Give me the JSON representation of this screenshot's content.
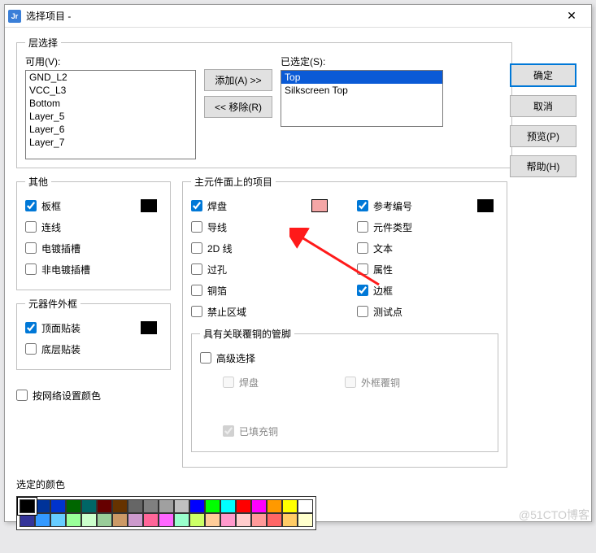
{
  "window": {
    "title": "选择项目 -"
  },
  "layerSelect": {
    "legend": "层选择",
    "availLabel": "可用(V):",
    "selectedLabel": "已选定(S):",
    "addBtn": "添加(A) >>",
    "removeBtn": "<< 移除(R)",
    "available": [
      "GND_L2",
      "VCC_L3",
      "Bottom",
      "Layer_5",
      "Layer_6",
      "Layer_7"
    ],
    "selected": [
      "Top",
      "Silkscreen Top"
    ]
  },
  "buttons": {
    "ok": "确定",
    "cancel": "取消",
    "preview": "预览(P)",
    "help": "帮助(H)"
  },
  "other": {
    "legend": "其他",
    "boardOutline": {
      "label": "板框",
      "checked": true,
      "color": "#000000"
    },
    "connections": {
      "label": "连线",
      "checked": false
    },
    "plated": {
      "label": "电镀插槽",
      "checked": false
    },
    "nonPlated": {
      "label": "非电镀插槽",
      "checked": false
    }
  },
  "compOutline": {
    "legend": "元器件外框",
    "top": {
      "label": "顶面贴装",
      "checked": true,
      "color": "#000000"
    },
    "bottom": {
      "label": "底层贴装",
      "checked": false
    }
  },
  "main": {
    "legend": "主元件面上的项目",
    "left": [
      {
        "label": "焊盘",
        "checked": true,
        "color": "#f4a6a6"
      },
      {
        "label": "导线",
        "checked": false
      },
      {
        "label": "2D 线",
        "checked": false
      },
      {
        "label": "过孔",
        "checked": false
      },
      {
        "label": "铜箔",
        "checked": false
      },
      {
        "label": "禁止区域",
        "checked": false
      }
    ],
    "right": [
      {
        "label": "参考编号",
        "checked": true,
        "color": "#000000"
      },
      {
        "label": "元件类型",
        "checked": false
      },
      {
        "label": "文本",
        "checked": false
      },
      {
        "label": "属性",
        "checked": false
      },
      {
        "label": "边框",
        "checked": true
      },
      {
        "label": "测试点",
        "checked": false
      }
    ],
    "assocLegend": "具有关联覆铜的管脚",
    "adv": {
      "label": "高级选择",
      "checked": false
    },
    "sub": [
      {
        "label": "焊盘",
        "checked": false
      },
      {
        "label": "外框覆铜",
        "checked": false
      },
      {
        "label": "已填充铜",
        "checked": true
      }
    ]
  },
  "byNet": {
    "label": "按网络设置颜色",
    "checked": false
  },
  "selectedColor": {
    "legend": "选定的颜色"
  },
  "palette": {
    "row1": [
      "#000000",
      "#003399",
      "#0033cc",
      "#006600",
      "#006666",
      "#660000",
      "#663300",
      "#666666",
      "#808080",
      "#a0a0a0",
      "#c0c0c0",
      "#0000ff",
      "#00ff00",
      "#00ffff",
      "#ff0000",
      "#ff00ff",
      "#ff9900",
      "#ffff00",
      "#ffffff"
    ],
    "row2": [
      "#333399",
      "#3399ff",
      "#66ccff",
      "#99ff99",
      "#ccffcc",
      "#99cc99",
      "#cc9966",
      "#cc99cc",
      "#ff6699",
      "#ff66ff",
      "#99ffcc",
      "#ccff66",
      "#ffcc99",
      "#ff99cc",
      "#ffcccc",
      "#ff9999",
      "#ff6666",
      "#ffcc66",
      "#ffffcc"
    ],
    "selected": 0
  },
  "watermark": "@51CTO博客"
}
